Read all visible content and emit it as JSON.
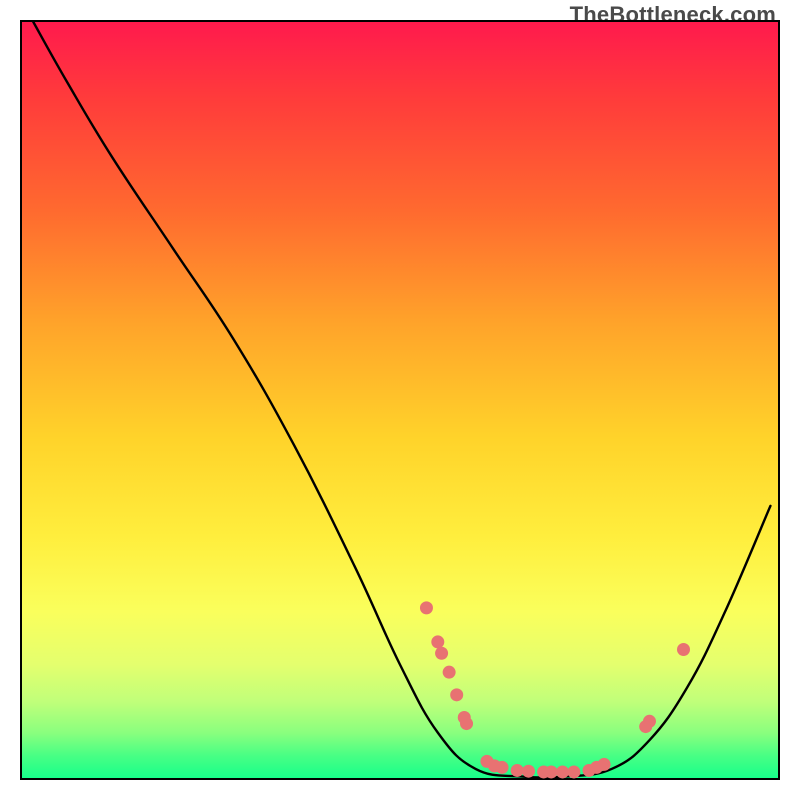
{
  "attribution": "TheBottleneck.com",
  "chart_data": {
    "type": "line",
    "title": "",
    "xlabel": "",
    "ylabel": "",
    "xlim": [
      0,
      100
    ],
    "ylim": [
      0,
      100
    ],
    "curve": {
      "name": "bottleneck-curve",
      "points": [
        {
          "x": 1.5,
          "y": 100
        },
        {
          "x": 6,
          "y": 92
        },
        {
          "x": 12,
          "y": 82
        },
        {
          "x": 20,
          "y": 70
        },
        {
          "x": 28,
          "y": 58
        },
        {
          "x": 36,
          "y": 44
        },
        {
          "x": 44,
          "y": 28
        },
        {
          "x": 50,
          "y": 15
        },
        {
          "x": 55,
          "y": 6
        },
        {
          "x": 60,
          "y": 1.2
        },
        {
          "x": 66,
          "y": 0.2
        },
        {
          "x": 72,
          "y": 0.2
        },
        {
          "x": 78,
          "y": 1.2
        },
        {
          "x": 83,
          "y": 5
        },
        {
          "x": 88,
          "y": 12
        },
        {
          "x": 93,
          "y": 22
        },
        {
          "x": 99,
          "y": 36
        }
      ]
    },
    "markers": [
      {
        "x": 53.5,
        "y": 22.5
      },
      {
        "x": 55.0,
        "y": 18.0
      },
      {
        "x": 55.5,
        "y": 16.5
      },
      {
        "x": 56.5,
        "y": 14.0
      },
      {
        "x": 57.5,
        "y": 11.0
      },
      {
        "x": 58.5,
        "y": 8.0
      },
      {
        "x": 58.8,
        "y": 7.2
      },
      {
        "x": 61.5,
        "y": 2.2
      },
      {
        "x": 62.5,
        "y": 1.6
      },
      {
        "x": 63.5,
        "y": 1.4
      },
      {
        "x": 65.5,
        "y": 1.0
      },
      {
        "x": 67.0,
        "y": 0.9
      },
      {
        "x": 69.0,
        "y": 0.8
      },
      {
        "x": 70.0,
        "y": 0.8
      },
      {
        "x": 71.5,
        "y": 0.8
      },
      {
        "x": 73.0,
        "y": 0.8
      },
      {
        "x": 75.0,
        "y": 1.0
      },
      {
        "x": 76.0,
        "y": 1.4
      },
      {
        "x": 77.0,
        "y": 1.8
      },
      {
        "x": 82.5,
        "y": 6.8
      },
      {
        "x": 83.0,
        "y": 7.5
      },
      {
        "x": 87.5,
        "y": 17.0
      }
    ],
    "colors": {
      "curve": "#000000",
      "marker_fill": "#e87272",
      "marker_stroke": "#c94f4f"
    }
  }
}
